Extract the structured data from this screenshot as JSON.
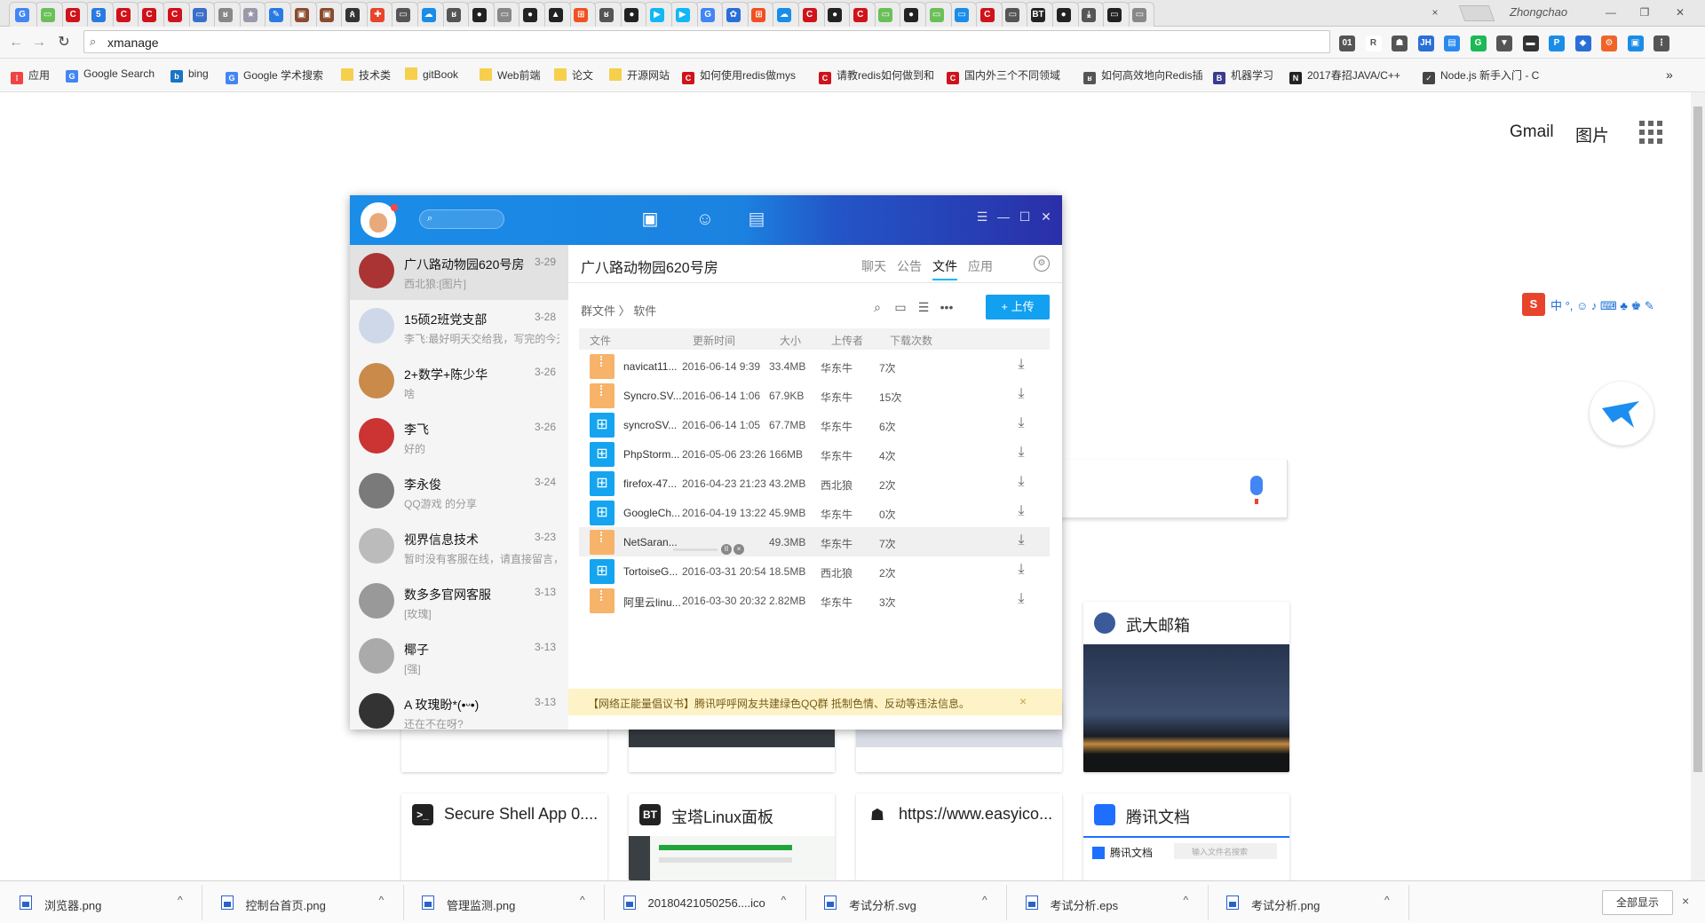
{
  "browser": {
    "active_tab_close": "×",
    "profile_name": "Zhongchao",
    "window_controls": [
      "—",
      "❐",
      "✕"
    ],
    "address": "xmanage",
    "bookmarks": [
      {
        "label": "应用",
        "icon": "apps-icon"
      },
      {
        "label": "Google Search",
        "icon": "google-icon"
      },
      {
        "label": "bing",
        "icon": "bing-icon"
      },
      {
        "label": "Google 学术搜索",
        "icon": "scholar-icon"
      },
      {
        "label": "技术类",
        "icon": "folder-icon"
      },
      {
        "label": "gitBook",
        "icon": "folder-icon"
      },
      {
        "label": "Web前端",
        "icon": "folder-icon"
      },
      {
        "label": "论文",
        "icon": "folder-icon"
      },
      {
        "label": "开源网站",
        "icon": "folder-icon"
      },
      {
        "label": "如何使用redis做mys",
        "icon": "csdn-icon"
      },
      {
        "label": "请教redis如何做到和",
        "icon": "csdn-icon"
      },
      {
        "label": "国内外三个不同领域",
        "icon": "csdn-icon"
      },
      {
        "label": "如何高效地向Redis插",
        "icon": "site-icon"
      },
      {
        "label": "机器学习",
        "icon": "b-icon"
      },
      {
        "label": "2017春招JAVA/C++",
        "icon": "nowcoder-icon"
      },
      {
        "label": "Node.js 新手入门 - C",
        "icon": "node-icon"
      }
    ],
    "bookmarks_more": "»"
  },
  "newtab": {
    "gmail": "Gmail",
    "images": "图片",
    "tiles_row1": [
      {
        "title": "武大邮箱",
        "icon": "whu-icon"
      }
    ],
    "tiles_row2": [
      {
        "title": "Secure Shell App 0....",
        "icon": "terminal-icon",
        "icon_text": ">_"
      },
      {
        "title": "宝塔Linux面板",
        "icon": "bt-icon",
        "icon_text": "BT"
      },
      {
        "title": "https://www.easyico...",
        "icon": "github-icon",
        "icon_text": ""
      },
      {
        "title": "腾讯文档",
        "icon": "tencent-docs-icon",
        "icon_text": ""
      }
    ],
    "tencent_docs_thumb_title": "腾讯文档",
    "tencent_docs_thumb_search": "输入文件名搜索",
    "ime": "中 °, ☺ ♪ ⌨ ♣ ♚ ✎"
  },
  "qq": {
    "search_icon": "⌕",
    "nav": [
      "chat-icon",
      "contacts-icon",
      "apps-icon"
    ],
    "window_buttons": [
      "☰",
      "—",
      "☐",
      "✕"
    ],
    "conversations": [
      {
        "name": "广八路动物园620号房",
        "date": "3-29",
        "preview": "西北狼:[图片]",
        "color": "#a33"
      },
      {
        "name": "15硕2班党支部",
        "date": "3-28",
        "preview": "李飞:最好明天交给我，写完的今天",
        "color": "#cfd8e8"
      },
      {
        "name": "2+数学+陈少华",
        "date": "3-26",
        "preview": "啥",
        "color": "#c98a4a"
      },
      {
        "name": "李飞",
        "date": "3-26",
        "preview": "好的",
        "color": "#c33"
      },
      {
        "name": "李永俊",
        "date": "3-24",
        "preview": "QQ游戏 的分享",
        "color": "#7a7a7a"
      },
      {
        "name": "视界信息技术",
        "date": "3-23",
        "preview": "暂时没有客服在线，请直接留言，",
        "color": "#bbb"
      },
      {
        "name": "数多多官网客服",
        "date": "3-13",
        "preview": "[玫瑰]",
        "color": "#999"
      },
      {
        "name": "椰子",
        "date": "3-13",
        "preview": "[强]",
        "color": "#aaa"
      },
      {
        "name": "A 玫瑰盼*(•ᵕ•)",
        "date": "3-13",
        "preview": "还在不在呀?",
        "color": "#333"
      }
    ],
    "group_title": "广八路动物园620号房",
    "tabs": [
      "聊天",
      "公告",
      "文件",
      "应用"
    ],
    "active_tab": "文件",
    "breadcrumb": "群文件 〉 软件",
    "toolbar_icons": [
      "⌕",
      "▭",
      "☰",
      "•••"
    ],
    "upload_label": "+ 上传",
    "columns": [
      "文件",
      "更新时间",
      "大小",
      "上传者",
      "下载次数"
    ],
    "files": [
      {
        "name": "navicat11...",
        "time": "2016-06-14 9:39",
        "size": "33.4MB",
        "uploader": "华东牛",
        "downloads": "7次",
        "type": "zip"
      },
      {
        "name": "Syncro.SV...",
        "time": "2016-06-14 1:06",
        "size": "67.9KB",
        "uploader": "华东牛",
        "downloads": "15次",
        "type": "zip"
      },
      {
        "name": "syncroSV...",
        "time": "2016-06-14 1:05",
        "size": "67.7MB",
        "uploader": "华东牛",
        "downloads": "6次",
        "type": "win"
      },
      {
        "name": "PhpStorm...",
        "time": "2016-05-06 23:26",
        "size": "166MB",
        "uploader": "华东牛",
        "downloads": "4次",
        "type": "win"
      },
      {
        "name": "firefox-47...",
        "time": "2016-04-23 21:23",
        "size": "43.2MB",
        "uploader": "西北狼",
        "downloads": "2次",
        "type": "win"
      },
      {
        "name": "GoogleCh...",
        "time": "2016-04-19 13:22",
        "size": "45.9MB",
        "uploader": "华东牛",
        "downloads": "0次",
        "type": "win"
      },
      {
        "name": "NetSaran...",
        "time": "",
        "size": "49.3MB",
        "uploader": "华东牛",
        "downloads": "7次",
        "type": "zip",
        "downloading": true,
        "progress": 0.0
      },
      {
        "name": "TortoiseG...",
        "time": "2016-03-31 20:54",
        "size": "18.5MB",
        "uploader": "西北狼",
        "downloads": "2次",
        "type": "win"
      },
      {
        "name": "阿里云linu...",
        "time": "2016-03-30 20:32",
        "size": "2.82MB",
        "uploader": "华东牛",
        "downloads": "3次",
        "type": "zip"
      }
    ],
    "download_icon": "⤓",
    "notice": "【网络正能量倡议书】腾讯呼呼网友共建绿色QQ群 抵制色情、反动等违法信息。",
    "notice_close": "×"
  },
  "downloads": {
    "items": [
      "浏览器.png",
      "控制台首页.png",
      "管理监测.png",
      "20180421050256....ico",
      "考试分析.svg",
      "考试分析.eps",
      "考试分析.png"
    ],
    "chevron": "^",
    "show_all": "全部显示",
    "close": "×"
  }
}
